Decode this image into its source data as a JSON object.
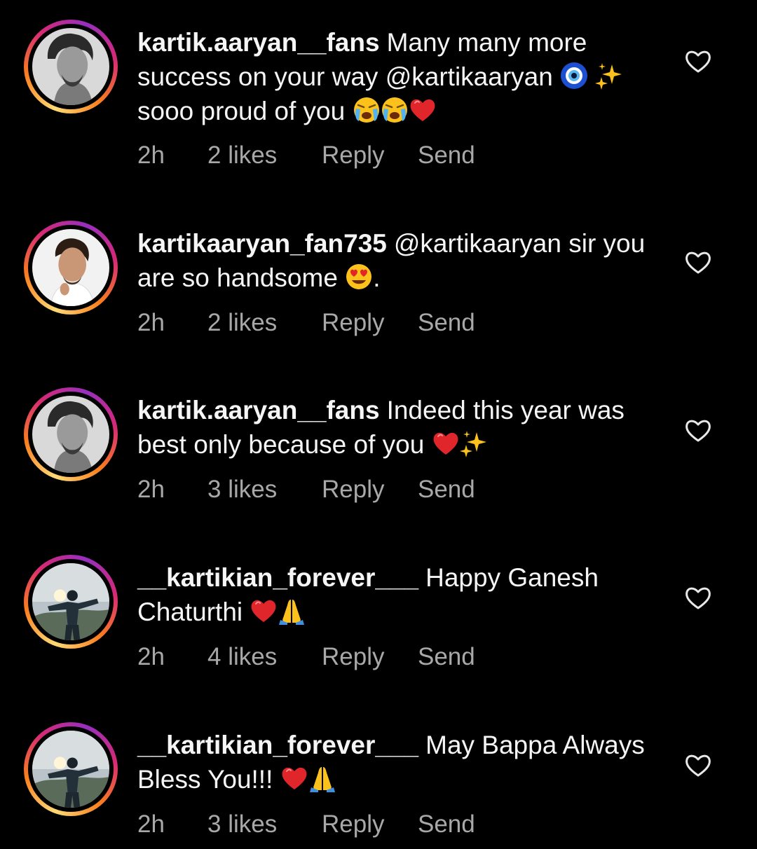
{
  "comments": [
    {
      "username": "kartik.aaryan__fans",
      "text_1": "Many many more success on your way @kartikaaryan",
      "text_2": "sooo proud of you",
      "time": "2h",
      "likes": "2 likes",
      "reply_label": "Reply",
      "send_label": "Send"
    },
    {
      "username": "kartikaaryan_fan735",
      "text_1": "@kartikaaryan sir you are so handsome",
      "text_2": ".",
      "time": "2h",
      "likes": "2 likes",
      "reply_label": "Reply",
      "send_label": "Send"
    },
    {
      "username": "kartik.aaryan__fans",
      "text_1": "Indeed this year was best only because of you",
      "time": "2h",
      "likes": "3 likes",
      "reply_label": "Reply",
      "send_label": "Send"
    },
    {
      "username": "__kartikian_forever___",
      "text_1": "Happy Ganesh Chaturthi",
      "time": "2h",
      "likes": "4 likes",
      "reply_label": "Reply",
      "send_label": "Send"
    },
    {
      "username": "__kartikian_forever___",
      "text_1": "May Bappa Always Bless You!!!",
      "time": "2h",
      "likes": "3 likes",
      "reply_label": "Reply",
      "send_label": "Send"
    }
  ],
  "icons": {
    "like": "heart-outline-icon",
    "nazar": "nazar-amulet-emoji",
    "sparkles": "sparkles-emoji",
    "crying": "loudly-crying-face-emoji",
    "heart": "red-heart-emoji",
    "heart_eyes": "heart-eyes-emoji",
    "folded_hands": "folded-hands-emoji"
  },
  "colors": {
    "background": "#000000",
    "primary_text": "#f5f5f5",
    "secondary_text": "#a8a8a8",
    "story_ring_start": "#feda75",
    "story_ring_end": "#962fbf"
  }
}
